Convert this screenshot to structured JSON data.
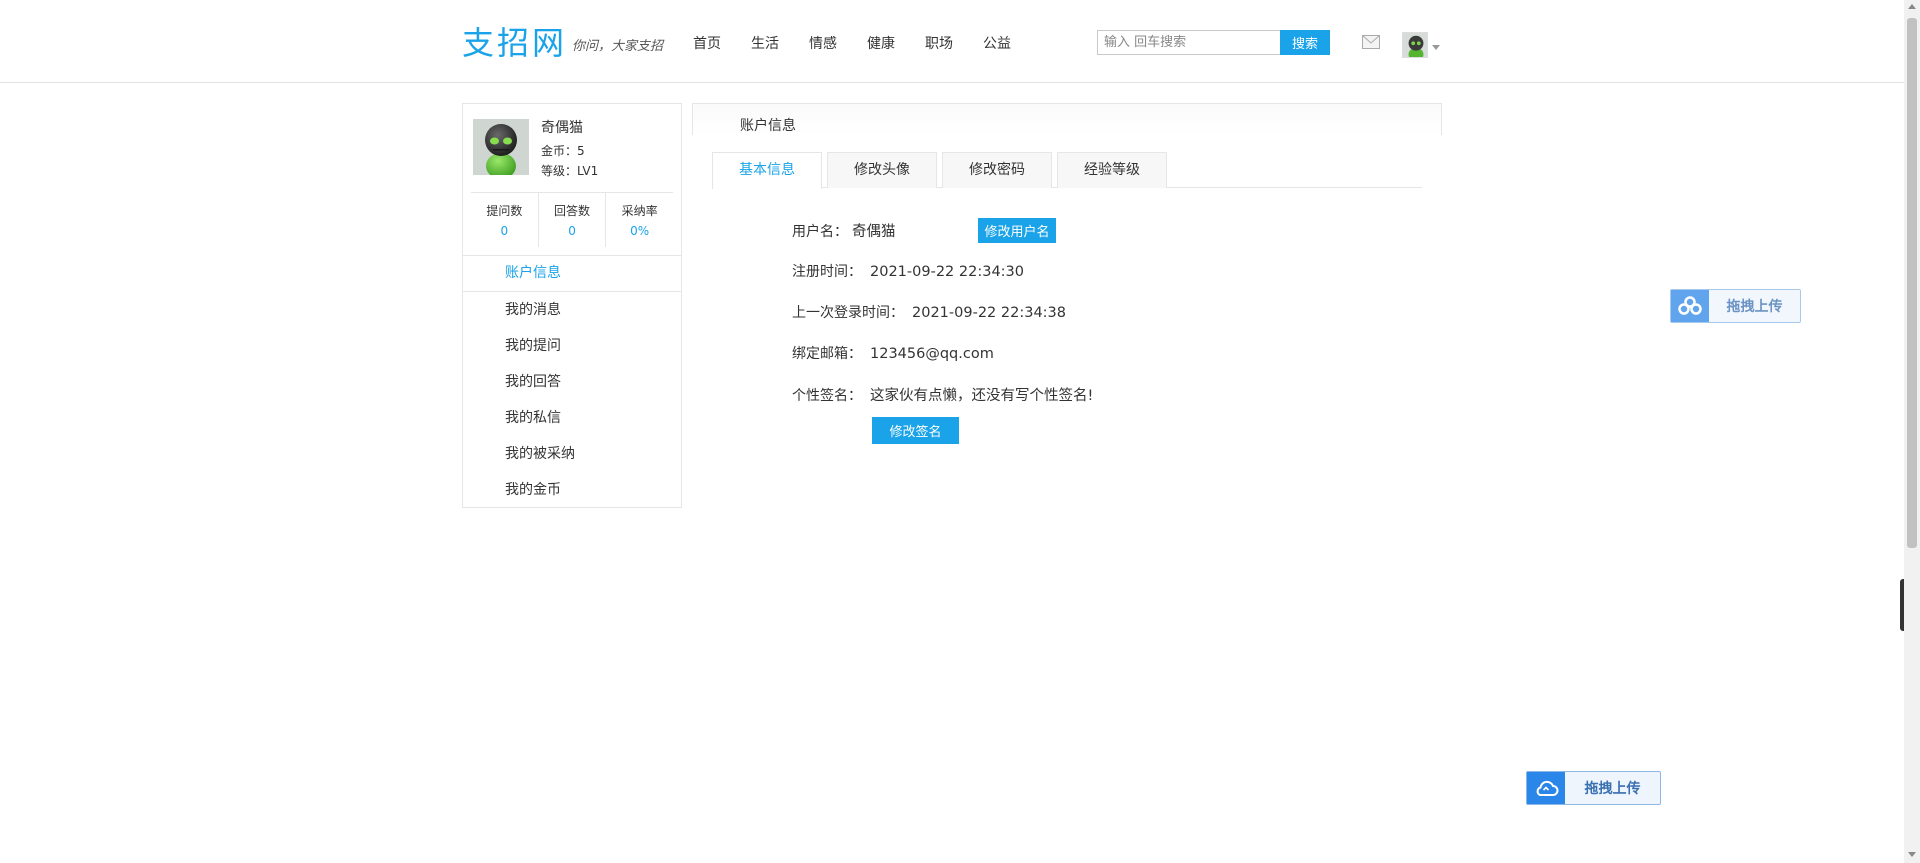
{
  "header": {
    "logo": "支招网",
    "slogan": "你问，大家支招",
    "nav": [
      "首页",
      "生活",
      "情感",
      "健康",
      "职场",
      "公益"
    ],
    "search_placeholder": "输入 回车搜索",
    "search_button": "搜索",
    "icons": {
      "mail": "mail-icon",
      "avatar": "avatar",
      "caret": "caret-down-icon"
    }
  },
  "profile": {
    "name": "奇偶猫",
    "gold": "金币：5",
    "level": "等级：LV1",
    "stats": [
      {
        "label": "提问数",
        "value": "0"
      },
      {
        "label": "回答数",
        "value": "0"
      },
      {
        "label": "采纳率",
        "value": "0%"
      }
    ]
  },
  "side_menu": [
    "账户信息",
    "我的消息",
    "我的提问",
    "我的回答",
    "我的私信",
    "我的被采纳",
    "我的金币"
  ],
  "panel": {
    "title": "账户信息",
    "tabs": [
      "基本信息",
      "修改头像",
      "修改密码",
      "经验等级"
    ],
    "fields": {
      "username_label": "用户名：",
      "username_value": "奇偶猫",
      "edit_username_button": "修改用户名",
      "register_label": "注册时间：",
      "register_value": "2021-09-22 22:34:30",
      "last_login_label": "上一次登录时间：",
      "last_login_value": "2021-09-22 22:34:38",
      "email_label": "绑定邮箱：",
      "email_value": "123456@qq.com",
      "signature_label": "个性签名：",
      "signature_value": "这家伙有点懒，还没有写个性签名!",
      "edit_signature_button": "修改签名"
    }
  },
  "upload_widgets": [
    "拖拽上传",
    "拖拽上传"
  ],
  "colors": {
    "accent": "#1aa3e8",
    "upload_blue": "#2a86e8"
  }
}
